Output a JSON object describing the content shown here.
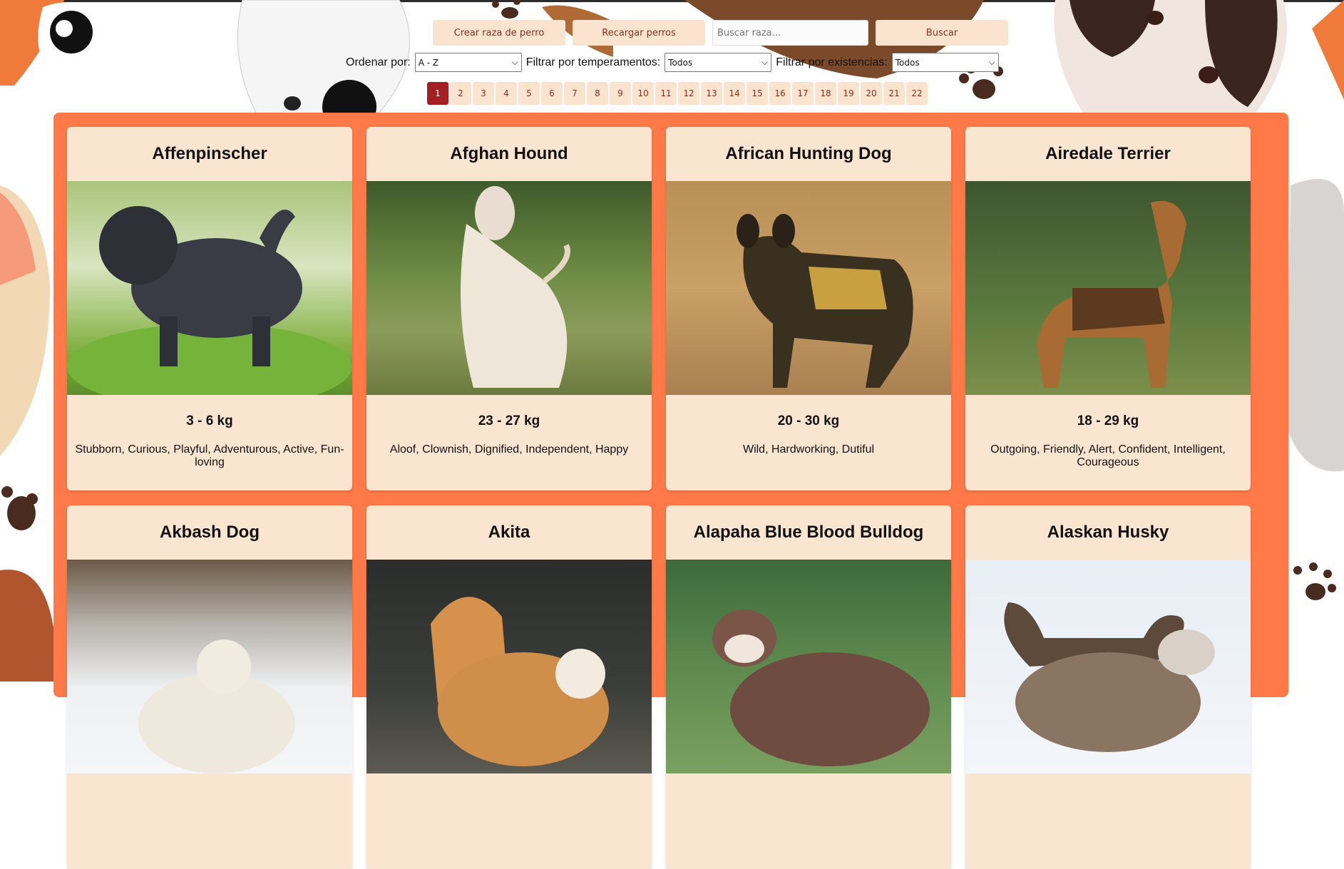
{
  "toolbar": {
    "create_label": "Crear raza de perro",
    "reload_label": "Recargar perros",
    "search_placeholder": "Buscar raza...",
    "search_value": "",
    "search_button": "Buscar"
  },
  "filters": {
    "order_label": "Ordenar por:",
    "order_value": "A - Z",
    "temper_label": "Filtrar por temperamentos:",
    "temper_value": "Todos",
    "exist_label": "Filtrar por existencias:",
    "exist_value": "Todos"
  },
  "pagination": {
    "pages": [
      "1",
      "2",
      "3",
      "4",
      "5",
      "6",
      "7",
      "8",
      "9",
      "10",
      "11",
      "12",
      "13",
      "14",
      "15",
      "16",
      "17",
      "18",
      "19",
      "20",
      "21",
      "22"
    ],
    "active": "1"
  },
  "breeds": [
    {
      "name": "Affenpinscher",
      "weight": "3 - 6 kg",
      "temperament": "Stubborn, Curious, Playful, Adventurous, Active, Fun-loving"
    },
    {
      "name": "Afghan Hound",
      "weight": "23 - 27 kg",
      "temperament": "Aloof, Clownish, Dignified, Independent, Happy"
    },
    {
      "name": "African Hunting Dog",
      "weight": "20 - 30 kg",
      "temperament": "Wild, Hardworking, Dutiful"
    },
    {
      "name": "Airedale Terrier",
      "weight": "18 - 29 kg",
      "temperament": "Outgoing, Friendly, Alert, Confident, Intelligent, Courageous"
    },
    {
      "name": "Akbash Dog",
      "weight": "",
      "temperament": ""
    },
    {
      "name": "Akita",
      "weight": "",
      "temperament": ""
    },
    {
      "name": "Alapaha Blue Blood Bulldog",
      "weight": "",
      "temperament": ""
    },
    {
      "name": "Alaskan Husky",
      "weight": "",
      "temperament": ""
    }
  ],
  "colors": {
    "panel": "#ff7a48",
    "card": "#fae6d0",
    "button_bg": "#fbe4cf",
    "button_text": "#8b2f1f",
    "active_page": "#a31f24"
  }
}
